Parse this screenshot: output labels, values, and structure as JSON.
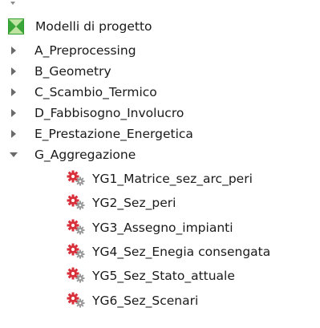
{
  "tree": {
    "root": {
      "label": "Modelli di progetto",
      "icon": "model-group-icon"
    },
    "groups": [
      {
        "label": "A_Preprocessing",
        "expanded": false
      },
      {
        "label": "B_Geometry",
        "expanded": false
      },
      {
        "label": "C_Scambio_Termico",
        "expanded": false
      },
      {
        "label": "D_Fabbisogno_Involucro",
        "expanded": false
      },
      {
        "label": "E_Prestazione_Energetica",
        "expanded": false
      },
      {
        "label": "G_Aggregazione",
        "expanded": true
      }
    ],
    "children": [
      {
        "label": "YG1_Matrice_sez_arc_peri",
        "icon": "gears-model-icon"
      },
      {
        "label": "YG2_Sez_peri",
        "icon": "gears-model-icon"
      },
      {
        "label": "YG3_Assegno_impianti",
        "icon": "gears-model-icon"
      },
      {
        "label": "YG4_Sez_Enegia consengata",
        "icon": "gears-model-icon"
      },
      {
        "label": "YG5_Sez_Stato_attuale",
        "icon": "gears-model-icon"
      },
      {
        "label": "YG6_Sez_Scenari",
        "icon": "gears-model-icon"
      }
    ]
  },
  "colors": {
    "model_icon_green": "#2f9e2f",
    "model_icon_light": "#cfe9b8",
    "gear_red": "#d8303a",
    "gear_gray": "#9a9a9a",
    "arrow": "#6a6a6a",
    "text": "#1a1a1a"
  }
}
